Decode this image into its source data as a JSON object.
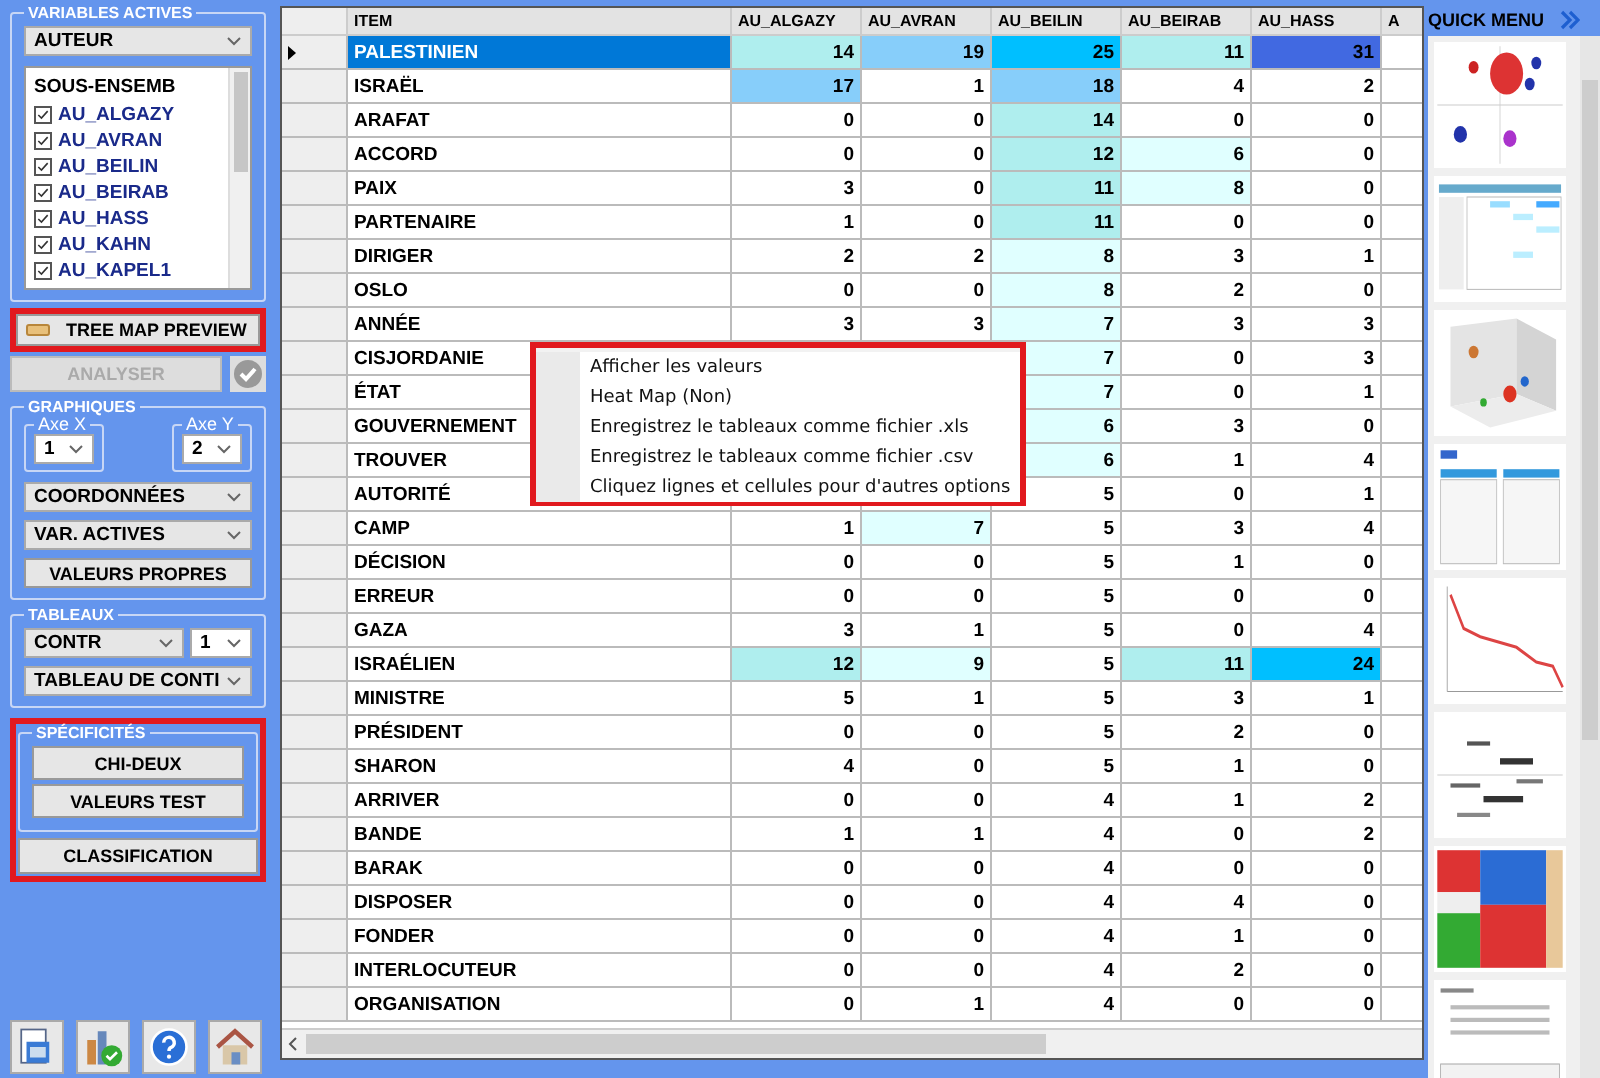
{
  "left_panel": {
    "variables_actives": {
      "label": "VARIABLES ACTIVES",
      "dropdown": "AUTEUR",
      "list_header": "SOUS-ENSEMB",
      "items": [
        {
          "label": "AU_ALGAZY",
          "checked": true
        },
        {
          "label": "AU_AVRAN",
          "checked": true
        },
        {
          "label": "AU_BEILIN",
          "checked": true
        },
        {
          "label": "AU_BEIRAB",
          "checked": true
        },
        {
          "label": "AU_HASS",
          "checked": true
        },
        {
          "label": "AU_KAHN",
          "checked": true
        },
        {
          "label": "AU_KAPEL1",
          "checked": true
        }
      ]
    },
    "tree_map_button": "TREE MAP PREVIEW",
    "analyser_button": {
      "label": "ANALYSER",
      "disabled": true
    },
    "graphiques": {
      "label": "GRAPHIQUES",
      "axe_x": {
        "label": "Axe X",
        "value": "1"
      },
      "axe_y": {
        "label": "Axe Y",
        "value": "2"
      },
      "dropdowns": [
        "COORDONNÉES",
        "VAR. ACTIVES"
      ],
      "button": "VALEURS PROPRES"
    },
    "tableaux": {
      "label": "TABLEAUX",
      "dropdowns": [
        "CONTR",
        "1",
        "TABLEAU DE CONTI"
      ]
    },
    "specificites": {
      "label": "SPÉCIFICITÉS",
      "buttons": [
        "CHI-DEUX",
        "VALEURS TEST"
      ]
    },
    "classification_button": "CLASSIFICATION",
    "toolbar": [
      {
        "kind": "save"
      },
      {
        "kind": "chart"
      },
      {
        "kind": "help"
      },
      {
        "kind": "home"
      }
    ]
  },
  "table": {
    "columns": [
      "ITEM",
      "AU_ALGAZY",
      "AU_AVRAN",
      "AU_BEILIN",
      "AU_BEIRAB",
      "AU_HASS",
      "A"
    ],
    "rows": [
      {
        "item": "PALESTINIEN",
        "selected": true,
        "cells": [
          {
            "text": "14",
            "color": "#afeeee"
          },
          {
            "text": "19",
            "color": "#87cefa"
          },
          {
            "text": "25",
            "color": "#00bfff"
          },
          {
            "text": "11",
            "color": "#afeeee"
          },
          {
            "text": "31",
            "color": "#4169e1"
          }
        ]
      },
      {
        "item": "ISRAËL",
        "selected": false,
        "cells": [
          {
            "text": "17",
            "color": "#87cefa"
          },
          "1",
          {
            "text": "18",
            "color": "#87cefa"
          },
          "4",
          "2"
        ]
      },
      {
        "item": "ARAFAT",
        "selected": false,
        "cells": [
          "0",
          "0",
          {
            "text": "14",
            "color": "#afeeee"
          },
          "0",
          "0"
        ]
      },
      {
        "item": "ACCORD",
        "selected": false,
        "cells": [
          "0",
          "0",
          {
            "text": "12",
            "color": "#afeeee"
          },
          {
            "text": "6",
            "color": "#e0ffff"
          },
          "0"
        ]
      },
      {
        "item": "PAIX",
        "selected": false,
        "cells": [
          "3",
          "0",
          {
            "text": "11",
            "color": "#afeeee"
          },
          {
            "text": "8",
            "color": "#e0ffff"
          },
          "0"
        ]
      },
      {
        "item": "PARTENAIRE",
        "selected": false,
        "cells": [
          "1",
          "0",
          {
            "text": "11",
            "color": "#afeeee"
          },
          "0",
          "0"
        ]
      },
      {
        "item": "DIRIGER",
        "selected": false,
        "cells": [
          "2",
          "2",
          {
            "text": "8",
            "color": "#e0ffff"
          },
          "3",
          "1"
        ]
      },
      {
        "item": "OSLO",
        "selected": false,
        "cells": [
          "0",
          "0",
          {
            "text": "8",
            "color": "#e0ffff"
          },
          "2",
          "0"
        ]
      },
      {
        "item": "ANNÉE",
        "selected": false,
        "cells": [
          "3",
          "3",
          {
            "text": "7",
            "color": "#e0ffff"
          },
          "3",
          "3"
        ]
      },
      {
        "item": "CISJORDANIE",
        "selected": false,
        "cells": [
          null,
          null,
          {
            "text": "7",
            "color": "#e0ffff"
          },
          "0",
          "3"
        ]
      },
      {
        "item": "ÉTAT",
        "selected": false,
        "cells": [
          null,
          null,
          {
            "text": "7",
            "color": "#e0ffff"
          },
          "0",
          "1"
        ]
      },
      {
        "item": "GOUVERNEMENT",
        "selected": false,
        "cells": [
          null,
          null,
          {
            "text": "6",
            "color": "#e0ffff"
          },
          "3",
          "0"
        ]
      },
      {
        "item": "TROUVER",
        "selected": false,
        "cells": [
          null,
          null,
          {
            "text": "6",
            "color": "#e0ffff"
          },
          "1",
          "4"
        ]
      },
      {
        "item": "AUTORITÉ",
        "selected": false,
        "cells": [
          null,
          null,
          "5",
          "0",
          "1"
        ]
      },
      {
        "item": "CAMP",
        "selected": false,
        "cells": [
          "1",
          {
            "text": "7",
            "color": "#e0ffff"
          },
          "5",
          "3",
          "4"
        ]
      },
      {
        "item": "DÉCISION",
        "selected": false,
        "cells": [
          "0",
          "0",
          "5",
          "1",
          "0"
        ]
      },
      {
        "item": "ERREUR",
        "selected": false,
        "cells": [
          "0",
          "0",
          "5",
          "0",
          "0"
        ]
      },
      {
        "item": "GAZA",
        "selected": false,
        "cells": [
          "3",
          "1",
          "5",
          "0",
          "4"
        ]
      },
      {
        "item": "ISRAÉLIEN",
        "selected": false,
        "cells": [
          {
            "text": "12",
            "color": "#afeeee"
          },
          {
            "text": "9",
            "color": "#e0ffff"
          },
          "5",
          {
            "text": "11",
            "color": "#afeeee"
          },
          {
            "text": "24",
            "color": "#00bfff"
          }
        ]
      },
      {
        "item": "MINISTRE",
        "selected": false,
        "cells": [
          "5",
          "1",
          "5",
          "3",
          "1"
        ]
      },
      {
        "item": "PRÉSIDENT",
        "selected": false,
        "cells": [
          "0",
          "0",
          "5",
          "2",
          "0"
        ]
      },
      {
        "item": "SHARON",
        "selected": false,
        "cells": [
          "4",
          "0",
          "5",
          "1",
          "0"
        ]
      },
      {
        "item": "ARRIVER",
        "selected": false,
        "cells": [
          "0",
          "0",
          "4",
          "1",
          "2"
        ]
      },
      {
        "item": "BANDE",
        "selected": false,
        "cells": [
          "1",
          "1",
          "4",
          "0",
          "2"
        ]
      },
      {
        "item": "BARAK",
        "selected": false,
        "cells": [
          "0",
          "0",
          "4",
          "0",
          "0"
        ]
      },
      {
        "item": "DISPOSER",
        "selected": false,
        "cells": [
          "0",
          "0",
          "4",
          "4",
          "0"
        ]
      },
      {
        "item": "FONDER",
        "selected": false,
        "cells": [
          "0",
          "0",
          "4",
          "1",
          "0"
        ]
      },
      {
        "item": "INTERLOCUTEUR",
        "selected": false,
        "cells": [
          "0",
          "0",
          "4",
          "2",
          "0"
        ]
      },
      {
        "item": "ORGANISATION",
        "selected": false,
        "cells": [
          "0",
          "1",
          "4",
          "0",
          "0"
        ]
      }
    ]
  },
  "context_menu": {
    "items": [
      "Afficher les valeurs",
      "Heat Map (Non)",
      "Enregistrez le tableaux comme fichier .xls",
      "Enregistrez le tableaux comme fichier .csv",
      "Cliquez lignes et cellules pour d'autres options"
    ]
  },
  "quick_menu": {
    "title": "QUICK MENU",
    "thumbnails": [
      {
        "kind": "bubble"
      },
      {
        "kind": "table"
      },
      {
        "kind": "scatter3d"
      },
      {
        "kind": "tables"
      },
      {
        "kind": "line"
      },
      {
        "kind": "wordmap"
      },
      {
        "kind": "treemap"
      },
      {
        "kind": "report"
      }
    ]
  }
}
